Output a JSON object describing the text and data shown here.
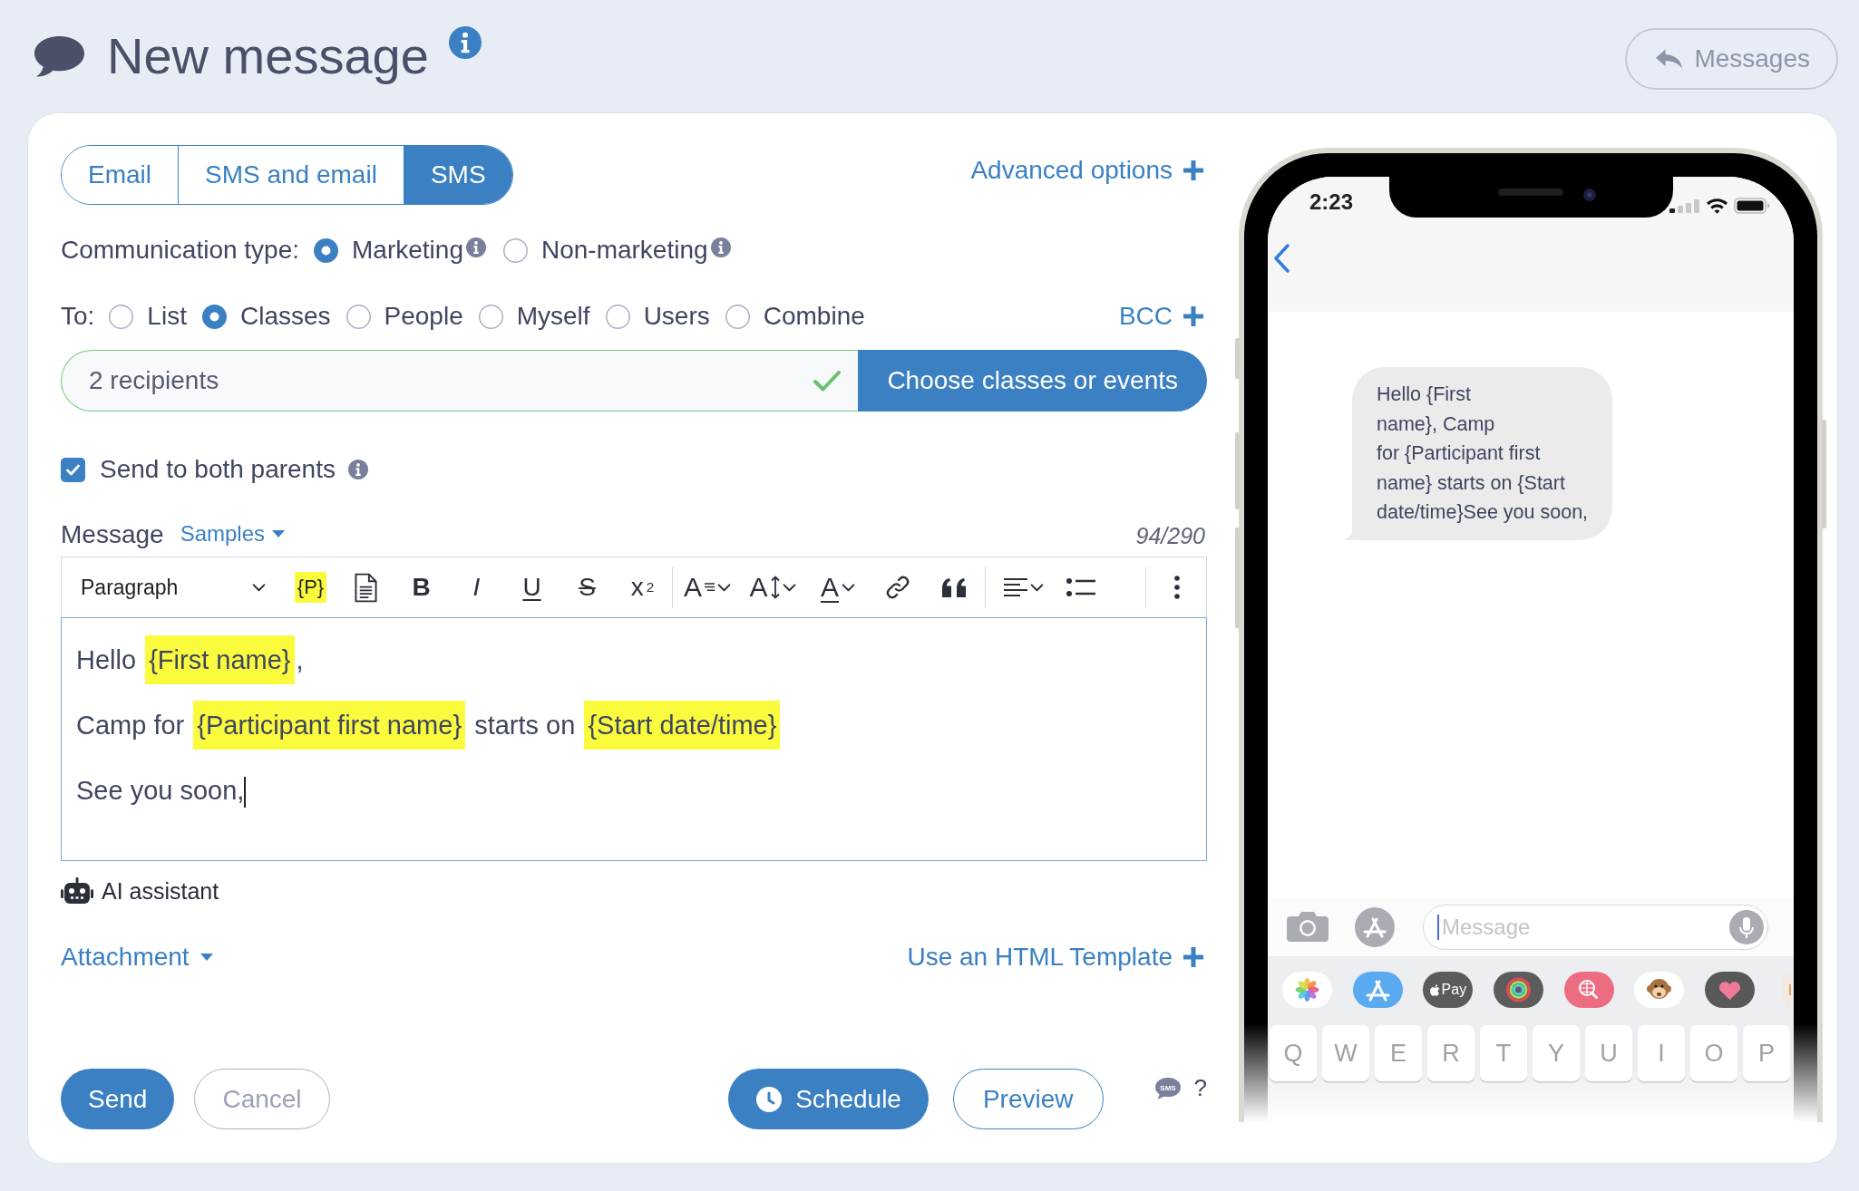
{
  "header": {
    "title": "New message",
    "back_button": "Messages"
  },
  "channel_tabs": [
    {
      "label": "Email",
      "selected": false
    },
    {
      "label": "SMS and email",
      "selected": false
    },
    {
      "label": "SMS",
      "selected": true
    }
  ],
  "advanced_options": "Advanced options",
  "communication_type": {
    "label": "Communication type:",
    "options": [
      {
        "label": "Marketing",
        "selected": true
      },
      {
        "label": "Non-marketing",
        "selected": false
      }
    ]
  },
  "recipient_type": {
    "label": "To:",
    "options": [
      {
        "label": "List",
        "selected": false
      },
      {
        "label": "Classes",
        "selected": true
      },
      {
        "label": "People",
        "selected": false
      },
      {
        "label": "Myself",
        "selected": false
      },
      {
        "label": "Users",
        "selected": false
      },
      {
        "label": "Combine",
        "selected": false
      }
    ],
    "bcc": "BCC"
  },
  "recipients": {
    "value": "2 recipients",
    "valid": true,
    "button": "Choose classes or events"
  },
  "send_to_both_parents": {
    "label": "Send to both parents",
    "checked": true
  },
  "message": {
    "label": "Message",
    "samples": "Samples",
    "counter": "94/290",
    "toolbar": [
      {
        "kind": "block-format",
        "label": "Paragraph"
      },
      {
        "kind": "placeholder",
        "label": "{P}"
      },
      {
        "kind": "template"
      },
      {
        "kind": "bold",
        "label": "B"
      },
      {
        "kind": "italic",
        "label": "I"
      },
      {
        "kind": "underline",
        "label": "U"
      },
      {
        "kind": "strikethrough",
        "label": "S"
      },
      {
        "kind": "superscript",
        "label": "x$^{2}$"
      },
      {
        "kind": "divider"
      },
      {
        "kind": "font-size",
        "label": "A"
      },
      {
        "kind": "line-height",
        "label": "A"
      },
      {
        "kind": "font-color",
        "label": "A"
      },
      {
        "kind": "link"
      },
      {
        "kind": "quote"
      },
      {
        "kind": "divider"
      },
      {
        "kind": "align"
      },
      {
        "kind": "bullet-list"
      },
      {
        "kind": "divider"
      },
      {
        "kind": "more"
      }
    ],
    "paragraphs": [
      [
        {
          "kind": "text",
          "text": "Hello "
        },
        {
          "kind": "tag",
          "text": "{First name}"
        },
        {
          "kind": "text",
          "text": ","
        }
      ],
      [
        {
          "kind": "text",
          "text": "Camp for "
        },
        {
          "kind": "tag",
          "text": "{Participant first name}"
        },
        {
          "kind": "text",
          "text": " starts on "
        },
        {
          "kind": "tag",
          "text": "{Start date/time}"
        }
      ],
      [
        {
          "kind": "text",
          "text": "See you soon,"
        }
      ]
    ]
  },
  "ai_assistant": "AI assistant",
  "attachment": "Attachment",
  "html_template": "Use an HTML Template",
  "footer": {
    "send": "Send",
    "cancel": "Cancel",
    "schedule": "Schedule",
    "preview": "Preview",
    "sms_badge": "SMS",
    "help": "?"
  },
  "phone_preview": {
    "time": "2:23",
    "bubble_lines": [
      "Hello {First",
      "name}, Camp",
      "for {Participant first",
      "name} starts on {Start",
      "date/time}See you soon,"
    ],
    "input_placeholder": "Message",
    "apps": [
      {
        "kind": "photos"
      },
      {
        "kind": "store"
      },
      {
        "kind": "pay",
        "label": "Pay"
      },
      {
        "kind": "activity"
      },
      {
        "kind": "search"
      },
      {
        "kind": "monkey"
      },
      {
        "kind": "heart"
      },
      {
        "kind": "partial"
      }
    ],
    "keys": [
      "Q",
      "W",
      "E",
      "R",
      "T",
      "Y",
      "U",
      "I",
      "O",
      "P"
    ]
  }
}
